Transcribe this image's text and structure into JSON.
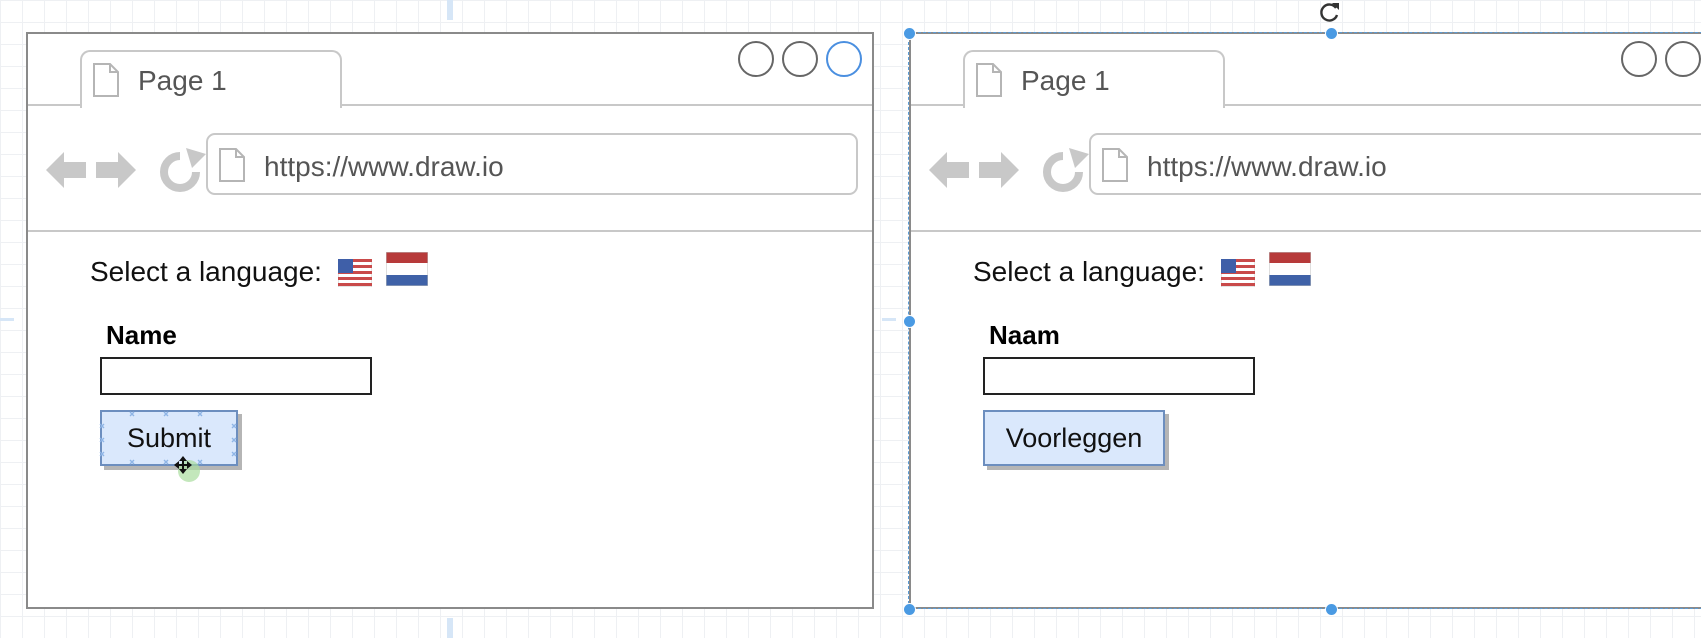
{
  "mockups": [
    {
      "tab_label": "Page 1",
      "url": "https://www.draw.io",
      "language_label": "Select a language:",
      "flags": [
        "us-flag-icon",
        "netherlands-flag-icon"
      ],
      "field_label": "Name",
      "field_value": "",
      "button_label": "Submit",
      "selected": false
    },
    {
      "tab_label": "Page 1",
      "url": "https://www.draw.io",
      "language_label": "Select a language:",
      "flags": [
        "us-flag-icon",
        "netherlands-flag-icon"
      ],
      "field_label": "Naam",
      "field_value": "",
      "button_label": "Voorleggen",
      "selected": true
    }
  ],
  "colors": {
    "button_fill": "#dae8fc",
    "button_border": "#6c8ebf",
    "selection": "#4a9ae3",
    "active_window_button": "#4a8fe0"
  },
  "icons": {
    "tab": "document-icon",
    "nav": [
      "back-arrow-icon",
      "forward-arrow-icon",
      "reload-icon"
    ],
    "url": "document-icon",
    "cursor": "move-cursor-icon",
    "rotate": "rotate-icon"
  }
}
